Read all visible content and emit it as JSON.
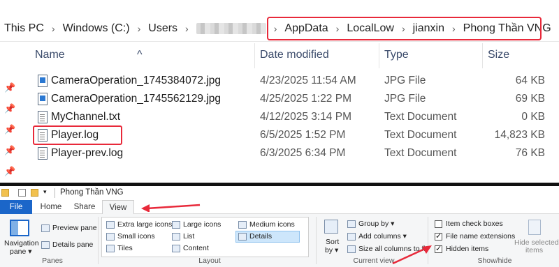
{
  "breadcrumb": [
    "This PC",
    "Windows (C:)",
    "Users",
    "AppData",
    "LocalLow",
    "jianxin",
    "Phong Thần VNG"
  ],
  "columns": {
    "name": "Name",
    "date": "Date modified",
    "type": "Type",
    "size": "Size"
  },
  "files": [
    {
      "name": "CameraOperation_1745384072.jpg",
      "date": "4/23/2025 11:54 AM",
      "type": "JPG File",
      "size": "64 KB",
      "icon": "image-file-icon"
    },
    {
      "name": "CameraOperation_1745562129.jpg",
      "date": "4/25/2025 1:22 PM",
      "type": "JPG File",
      "size": "69 KB",
      "icon": "image-file-icon"
    },
    {
      "name": "MyChannel.txt",
      "date": "4/12/2025 3:14 PM",
      "type": "Text Document",
      "size": "0 KB",
      "icon": "text-file-icon"
    },
    {
      "name": "Player.log",
      "date": "6/5/2025 1:52 PM",
      "type": "Text Document",
      "size": "14,823 KB",
      "icon": "text-file-icon"
    },
    {
      "name": "Player-prev.log",
      "date": "6/3/2025 6:34 PM",
      "type": "Text Document",
      "size": "76 KB",
      "icon": "text-file-icon"
    }
  ],
  "ribbon": {
    "window_title": "Phong Thần VNG",
    "tabs": {
      "file": "File",
      "home": "Home",
      "share": "Share",
      "view": "View"
    },
    "panes": {
      "navigation_pane": "Navigation",
      "navigation_pane2": "pane ▾",
      "preview_pane": "Preview pane",
      "details_pane": "Details pane",
      "label": "Panes"
    },
    "layout": {
      "extra_large": "Extra large icons",
      "large": "Large icons",
      "medium": "Medium icons",
      "small": "Small icons",
      "list": "List",
      "details": "Details",
      "tiles": "Tiles",
      "content": "Content",
      "label": "Layout"
    },
    "current_view": {
      "sort_by": "Sort",
      "sort_by2": "by ▾",
      "group_by": "Group by ▾",
      "add_columns": "Add columns ▾",
      "size_all": "Size all columns to fit",
      "label": "Current view"
    },
    "show_hide": {
      "item_check_boxes": "Item check boxes",
      "file_name_extensions": "File name extensions",
      "hidden_items": "Hidden items",
      "hide_selected": "Hide selected",
      "hide_selected2": "items",
      "label": "Show/hide",
      "item_check_boxes_checked": false,
      "file_name_extensions_checked": true,
      "hidden_items_checked": true
    }
  },
  "colors": {
    "highlight": "#e8293a",
    "file_tab": "#1b66c9"
  }
}
